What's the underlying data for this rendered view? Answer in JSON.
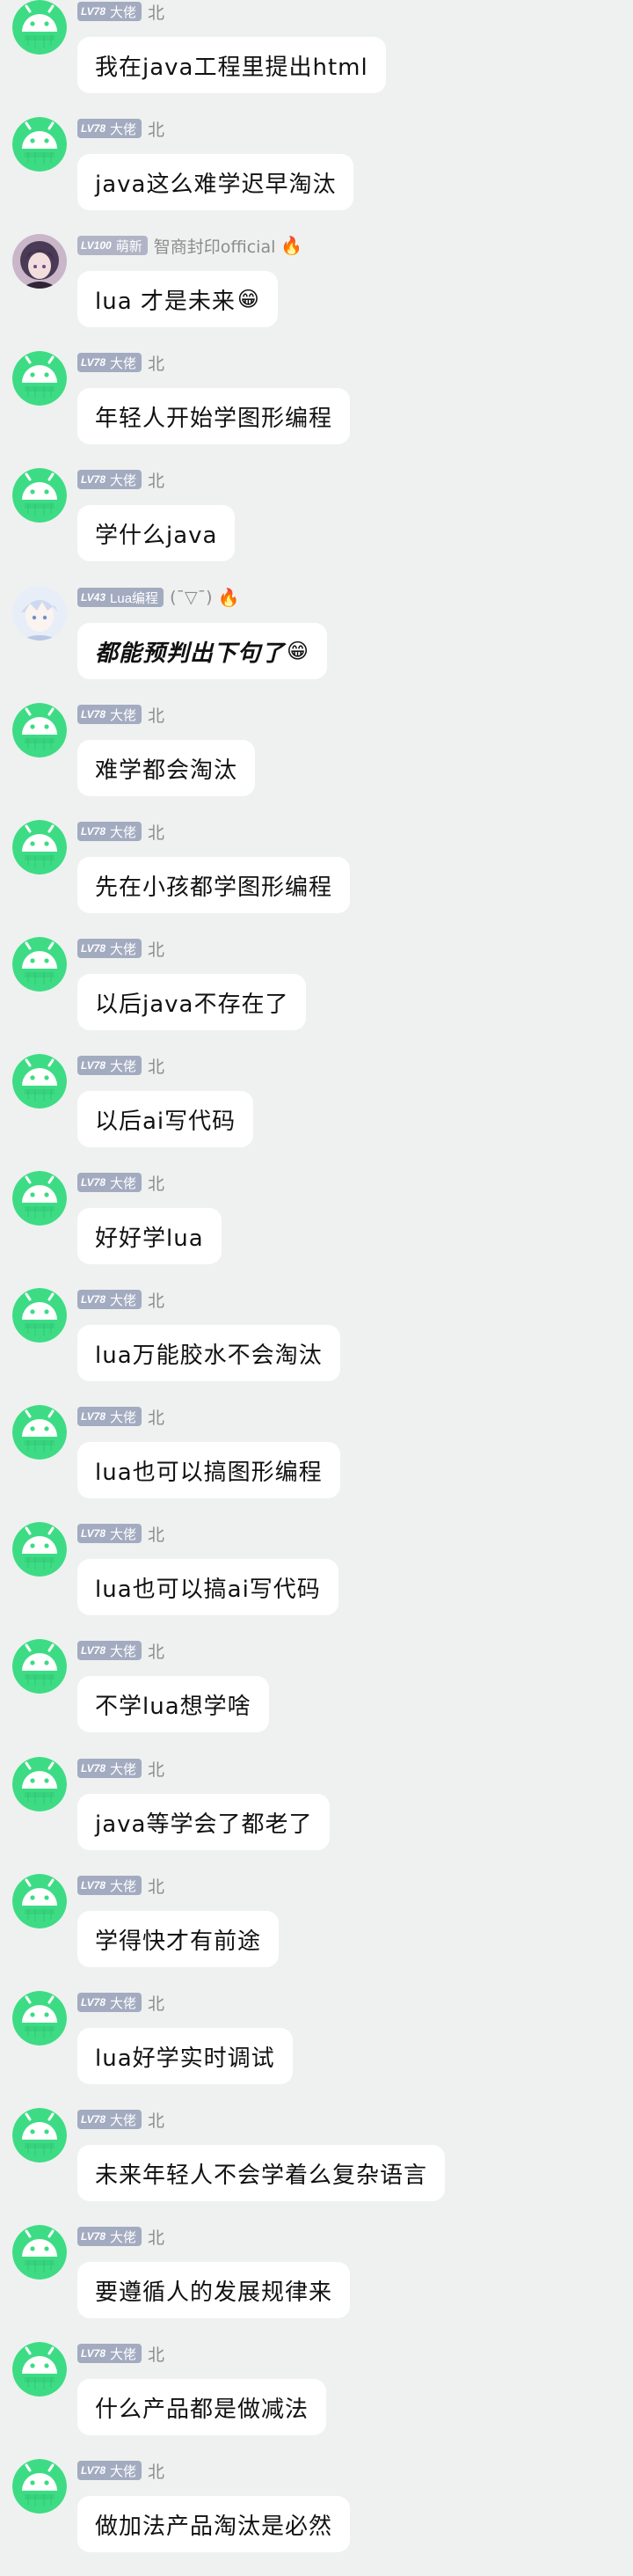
{
  "messages": [
    {
      "level": "LV78",
      "title": "大佬",
      "name": "北",
      "avatar": "android-avatar",
      "text": "我在java工程里提出html",
      "emoji": ""
    },
    {
      "level": "LV78",
      "title": "大佬",
      "name": "北",
      "avatar": "android-avatar",
      "text": "java这么难学迟早淘汰",
      "emoji": ""
    },
    {
      "level": "LV100",
      "title": "萌新",
      "name": "智商封印official",
      "avatar": "anime-girl-avatar",
      "flame": "🔥",
      "text": "lua 才是未来",
      "emoji": "😁"
    },
    {
      "level": "LV78",
      "title": "大佬",
      "name": "北",
      "avatar": "android-avatar",
      "text": "年轻人开始学图形编程",
      "emoji": ""
    },
    {
      "level": "LV78",
      "title": "大佬",
      "name": "北",
      "avatar": "android-avatar",
      "text": "学什么java",
      "emoji": ""
    },
    {
      "level": "LV43",
      "title": "Lua编程",
      "name": "(¯▽¯)",
      "avatar": "anime-boy-avatar",
      "flame": "🔥",
      "text": "都能预判出下句了",
      "emoji": "😁",
      "bold": true
    },
    {
      "level": "LV78",
      "title": "大佬",
      "name": "北",
      "avatar": "android-avatar",
      "text": "难学都会淘汰",
      "emoji": ""
    },
    {
      "level": "LV78",
      "title": "大佬",
      "name": "北",
      "avatar": "android-avatar",
      "text": "先在小孩都学图形编程",
      "emoji": ""
    },
    {
      "level": "LV78",
      "title": "大佬",
      "name": "北",
      "avatar": "android-avatar",
      "text": "以后java不存在了",
      "emoji": ""
    },
    {
      "level": "LV78",
      "title": "大佬",
      "name": "北",
      "avatar": "android-avatar",
      "text": "以后ai写代码",
      "emoji": ""
    },
    {
      "level": "LV78",
      "title": "大佬",
      "name": "北",
      "avatar": "android-avatar",
      "text": "好好学lua",
      "emoji": ""
    },
    {
      "level": "LV78",
      "title": "大佬",
      "name": "北",
      "avatar": "android-avatar",
      "text": "lua万能胶水不会淘汰",
      "emoji": ""
    },
    {
      "level": "LV78",
      "title": "大佬",
      "name": "北",
      "avatar": "android-avatar",
      "text": "lua也可以搞图形编程",
      "emoji": ""
    },
    {
      "level": "LV78",
      "title": "大佬",
      "name": "北",
      "avatar": "android-avatar",
      "text": "lua也可以搞ai写代码",
      "emoji": ""
    },
    {
      "level": "LV78",
      "title": "大佬",
      "name": "北",
      "avatar": "android-avatar",
      "text": "不学lua想学啥",
      "emoji": ""
    },
    {
      "level": "LV78",
      "title": "大佬",
      "name": "北",
      "avatar": "android-avatar",
      "text": "java等学会了都老了",
      "emoji": ""
    },
    {
      "level": "LV78",
      "title": "大佬",
      "name": "北",
      "avatar": "android-avatar",
      "text": "学得快才有前途",
      "emoji": ""
    },
    {
      "level": "LV78",
      "title": "大佬",
      "name": "北",
      "avatar": "android-avatar",
      "text": "lua好学实时调试",
      "emoji": ""
    },
    {
      "level": "LV78",
      "title": "大佬",
      "name": "北",
      "avatar": "android-avatar",
      "text": "未来年轻人不会学着么复杂语言",
      "emoji": ""
    },
    {
      "level": "LV78",
      "title": "大佬",
      "name": "北",
      "avatar": "android-avatar",
      "text": "要遵循人的发展规律来",
      "emoji": ""
    },
    {
      "level": "LV78",
      "title": "大佬",
      "name": "北",
      "avatar": "android-avatar",
      "text": "什么产品都是做减法",
      "emoji": ""
    },
    {
      "level": "LV78",
      "title": "大佬",
      "name": "北",
      "avatar": "android-avatar",
      "text": "做加法产品淘汰是必然",
      "emoji": ""
    }
  ],
  "colors": {
    "background": "#eef1ef",
    "android_green": "#3ddc84",
    "badge": "#a3abc0",
    "bubble": "#ffffff",
    "flame": "#f06a2c"
  }
}
